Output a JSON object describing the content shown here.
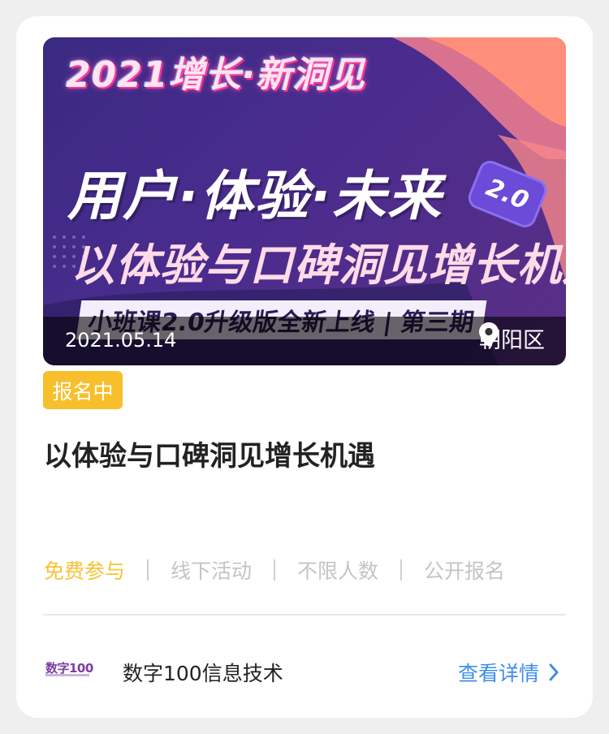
{
  "banner": {
    "top_text": "2021增长·新洞见",
    "headline": "用户·体验·未来",
    "badge": "2.0",
    "subline": "以体验与口碑洞见增长机遇",
    "strip": "小班课2.0升级版全新上线 | 第三期",
    "date": "2021.05.14",
    "location": "朝阳区"
  },
  "event": {
    "status": "报名中",
    "title": "以体验与口碑洞见增长机遇",
    "tags": [
      "免费参与",
      "线下活动",
      "不限人数",
      "公开报名"
    ]
  },
  "organizer": {
    "logo_text": "数字100",
    "name": "数字100信息技术",
    "detail_label": "查看详情"
  },
  "colors": {
    "status_bg": "#f8bf2c",
    "highlight_tag": "#f6c234",
    "link": "#3f8ee8"
  },
  "icons": {
    "location": "map-pin-icon",
    "chevron": "chevron-right-icon"
  }
}
